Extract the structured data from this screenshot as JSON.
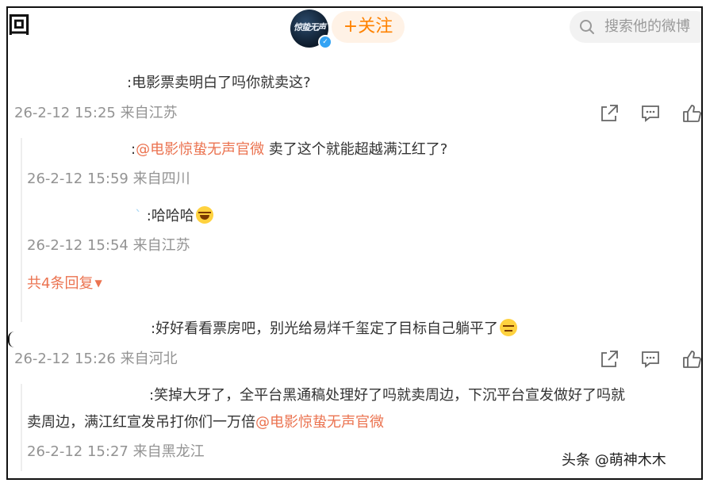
{
  "header": {
    "back_glyph": "回",
    "avatar_text": "惊蛰无声",
    "follow_label": "+关注",
    "search_placeholder": "搜索他的微博"
  },
  "comments": [
    {
      "text": ":电影票卖明白了吗你就卖这?",
      "meta": "26-2-12 15:25 来自江苏",
      "replies": [
        {
          "prefix": ":",
          "mention": "@电影惊蛰无声官微",
          "text": " 卖了这个就能超越满江红了?",
          "meta": "26-2-12 15:59 来自四川"
        },
        {
          "prefix": ":",
          "text": "哈哈哈",
          "emoji": "laugh",
          "meta": "26-2-12 15:54 来自江苏"
        }
      ],
      "more_replies": "共4条回复"
    },
    {
      "text": ":好好看看票房吧，别光给易烊千玺定了目标自己躺平了",
      "emoji": "meh",
      "meta": "26-2-12 15:26 来自河北",
      "replies": [
        {
          "line1": ":笑掉大牙了，全平台黑通稿处理好了吗就卖周边，下沉平台宣发做好了吗就",
          "line2_text": "卖周边，满江红宣发吊打你们一万倍",
          "mention": "@电影惊蛰无声官微",
          "meta": "26-2-12 15:27 来自黑龙江"
        }
      ]
    }
  ],
  "watermark": "头条 @萌神木木",
  "colors": {
    "accent": "#ff8200",
    "mention": "#eb7350",
    "meta": "#939393"
  }
}
